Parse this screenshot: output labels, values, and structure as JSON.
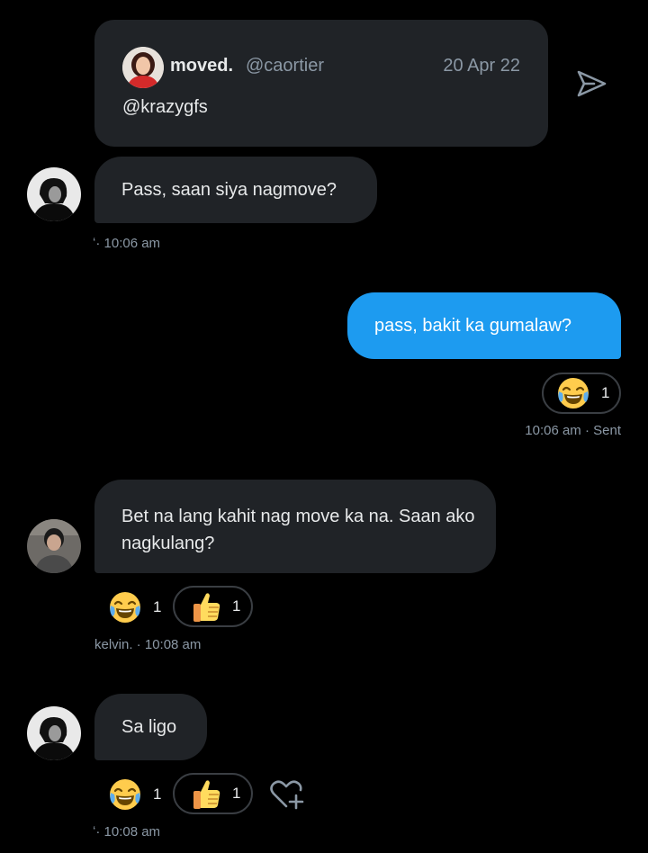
{
  "quoted_tweet": {
    "display_name": "moved.",
    "handle": "@caortier",
    "date": "20 Apr 22",
    "text": "@krazygfs"
  },
  "icons": {
    "share": "send-icon",
    "laugh": "face-with-tears-of-joy-icon",
    "thumbs": "thumbs-up-icon",
    "add_reaction": "heart-plus-icon"
  },
  "colors": {
    "outgoing_bubble": "#1d9bf0",
    "incoming_bubble": "#202327",
    "meta_text": "#8b98a5"
  },
  "messages": [
    {
      "text": "Pass, saan siya nagmove?",
      "meta_sender": "ʻ",
      "meta_time": "· 10:06 am"
    },
    {
      "text": "pass, bakit ka gumalaw?",
      "meta": "10:06 am · Sent",
      "reaction_count": "1"
    },
    {
      "text": "Bet na lang kahit nag move ka na. Saan ako nagkulang?",
      "meta": "kelvin. · 10:08 am",
      "laugh_count": "1",
      "thumbs_count": "1"
    },
    {
      "text": "Sa ligo",
      "meta_sender": "ʻ",
      "meta_time": "· 10:08 am",
      "laugh_count": "1",
      "thumbs_count": "1"
    }
  ]
}
